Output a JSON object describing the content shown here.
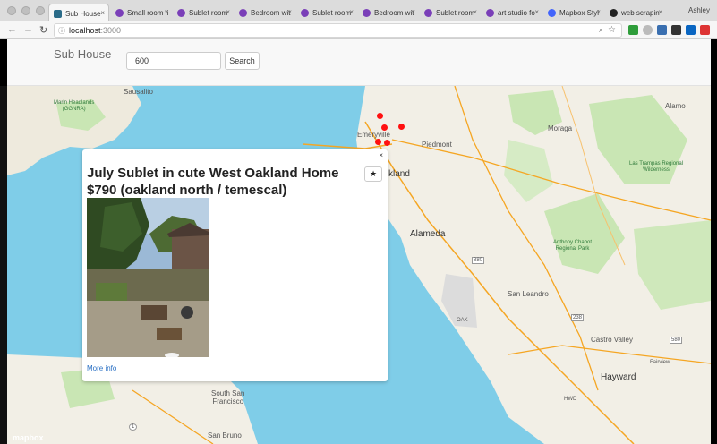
{
  "browser": {
    "tabs": [
      {
        "label": "Sub House",
        "icon": "app-favicon-icon",
        "active": true
      },
      {
        "label": "Small room li",
        "icon": "craigslist-peace-icon"
      },
      {
        "label": "Sublet room",
        "icon": "craigslist-peace-icon"
      },
      {
        "label": "Bedroom wit",
        "icon": "craigslist-peace-icon"
      },
      {
        "label": "Sublet room",
        "icon": "craigslist-peace-icon"
      },
      {
        "label": "Bedroom wit",
        "icon": "craigslist-peace-icon"
      },
      {
        "label": "Sublet room",
        "icon": "craigslist-peace-icon"
      },
      {
        "label": "art studio fo",
        "icon": "craigslist-peace-icon"
      },
      {
        "label": "Mapbox Styl",
        "icon": "mapbox-icon"
      },
      {
        "label": "web scrapin",
        "icon": "github-icon"
      }
    ],
    "tab_close": "×",
    "user": "Ashley",
    "url_host": "localhost",
    "url_port": ":3000"
  },
  "app": {
    "brand": "Sub House",
    "search": {
      "value": "600",
      "button": "Search"
    }
  },
  "map": {
    "labels": {
      "sausalito": "Sausalito",
      "marin": "Marin Headlands\n(GGNRA)",
      "emeryville": "Emeryville",
      "piedmont": "Piedmont",
      "oakland": "kland",
      "alameda": "Alameda",
      "moraga": "Moraga",
      "alamo": "Alamo",
      "las_trampas": "Las Trampas Regional\nWilderness",
      "chabot": "Anthony Chabot\nRegional Park",
      "san_leandro": "San Leandro",
      "oak": "OAK",
      "castro_valley": "Castro Valley",
      "fairview": "Fairview",
      "hayward": "Hayward",
      "hwd": "HWD",
      "south_sf": "South San\nFrancisco",
      "san_bruno": "San Bruno",
      "shield_880": "880",
      "shield_238": "238",
      "shield_580": "580",
      "shield_1": "1"
    },
    "attribution": "mapbox"
  },
  "popup": {
    "close": "×",
    "title": "July Sublet in cute West Oakland Home $790 (oakland north / temescal)",
    "favorite": "★",
    "more_info": "More info"
  },
  "colors": {
    "water": "#7fcde8",
    "land": "#f2efe6",
    "park": "#c9e6b4",
    "pin": "#ff1010",
    "link": "#2a70c4"
  }
}
